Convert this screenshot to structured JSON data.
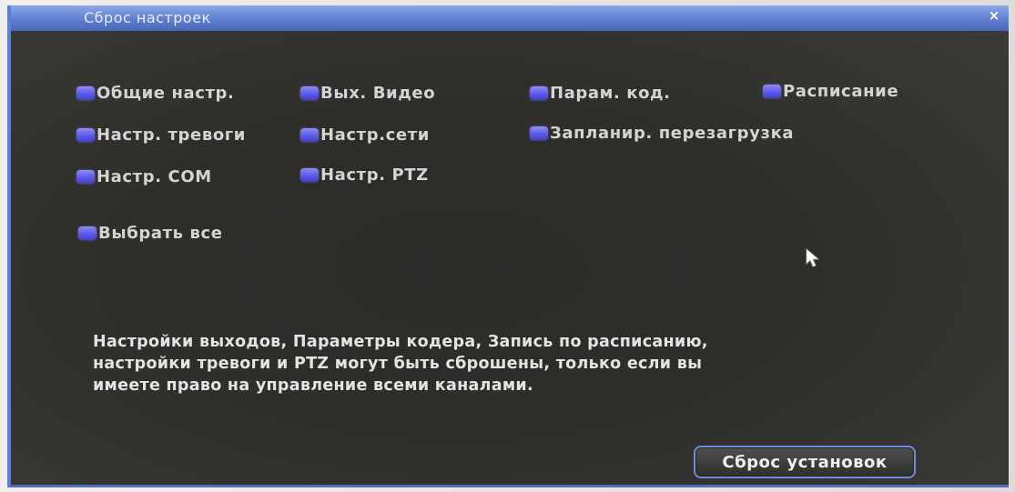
{
  "window": {
    "title": "Сброс настроек",
    "close_glyph": "×"
  },
  "options": [
    {
      "label": "Общие настр.",
      "checked": true
    },
    {
      "label": "Вых. Видео",
      "checked": true
    },
    {
      "label": "Парам. код.",
      "checked": true
    },
    {
      "label": "Расписание",
      "checked": true
    },
    {
      "label": "Настр. тревоги",
      "checked": true
    },
    {
      "label": "Настр.сети",
      "checked": true
    },
    {
      "label": "Запланир. перезагрузка",
      "checked": true
    },
    {
      "label": "Настр. COM",
      "checked": true
    },
    {
      "label": "Настр. PTZ",
      "checked": true
    }
  ],
  "select_all": {
    "label": "Выбрать все",
    "checked": true
  },
  "note": {
    "line1": "Настройки выходов, Параметры кодера, Запись по расписанию,",
    "line2": "настройки тревоги и PTZ могут быть сброшены, только если вы",
    "line3": "имеете право на управление всеми каналами."
  },
  "reset_button": {
    "label": "Сброс установок"
  },
  "colors": {
    "accent": "#5f7fd0",
    "checkbox": "#5a5ae6",
    "panel": "#302e2b",
    "text": "#d4d4d4"
  },
  "icons": {
    "cursor": "mouse-pointer-icon",
    "close": "close-icon"
  }
}
